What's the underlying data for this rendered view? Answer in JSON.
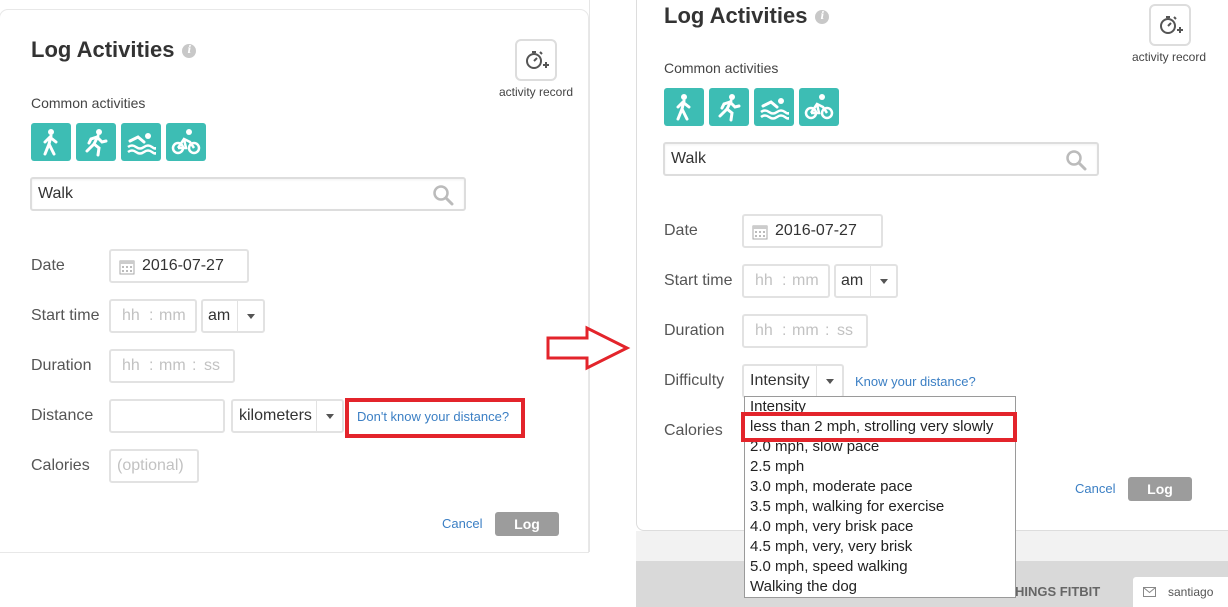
{
  "left": {
    "title": "Log Activities",
    "info_icon": "i",
    "activity_record_label": "activity record",
    "common_activities_label": "Common activities",
    "search_value": "Walk",
    "date_label": "Date",
    "date_value": "2016-07-27",
    "start_time_label": "Start time",
    "hh_placeholder": "hh",
    "mm_placeholder": "mm",
    "ss_placeholder": "ss",
    "colon": ":",
    "ampm_value": "am",
    "duration_label": "Duration",
    "distance_label": "Distance",
    "distance_unit": "kilometers",
    "dont_know_link": "Don't know your distance?",
    "calories_label": "Calories",
    "calories_placeholder": "(optional)",
    "cancel_label": "Cancel",
    "log_label": "Log"
  },
  "right": {
    "title": "Log Activities",
    "info_icon": "i",
    "activity_record_label": "activity record",
    "common_activities_label": "Common activities",
    "search_value": "Walk",
    "date_label": "Date",
    "date_value": "2016-07-27",
    "start_time_label": "Start time",
    "hh_placeholder": "hh",
    "mm_placeholder": "mm",
    "ss_placeholder": "ss",
    "colon": ":",
    "ampm_value": "am",
    "duration_label": "Duration",
    "difficulty_label": "Difficulty",
    "difficulty_value": "Intensity",
    "know_distance_link": "Know your distance?",
    "calories_label": "Calories",
    "cancel_label": "Cancel",
    "log_label": "Log",
    "dropdown_options": [
      "Intensity",
      "less than 2 mph, strolling very slowly",
      "2.0 mph, slow pace",
      "2.5 mph",
      "3.0 mph, moderate pace",
      "3.5 mph, walking for exercise",
      "4.0 mph, very brisk pace",
      "4.5 mph, very, very brisk",
      "5.0 mph, speed walking",
      "Walking the dog"
    ],
    "footer_text": "HINGS FITBIT",
    "user_text": "santiago"
  },
  "icons": [
    "walk-icon",
    "run-icon",
    "swim-icon",
    "bike-icon",
    "search-icon",
    "calendar-icon",
    "stopwatch-plus-icon",
    "envelope-icon",
    "arrow-right-icon"
  ],
  "colors": {
    "accent": "#3dbdb4",
    "link": "#3b7fc4",
    "highlight_red": "#e3242b",
    "log_button": "#9c9c9c"
  }
}
